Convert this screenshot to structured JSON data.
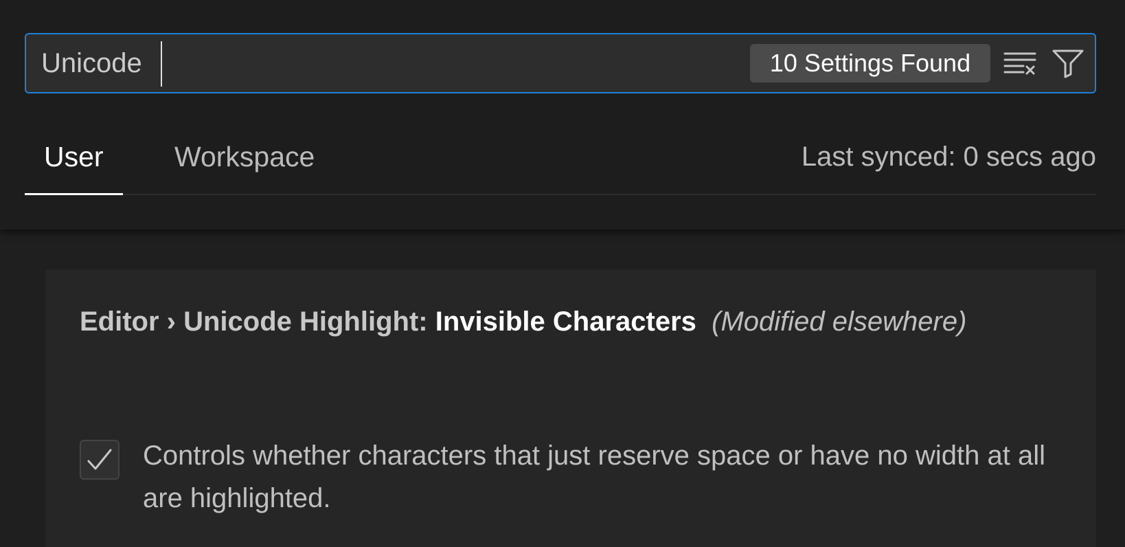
{
  "search": {
    "value": "Unicode",
    "result_count": "10 Settings Found"
  },
  "icons": {
    "clear": "clear-filter-icon",
    "filter": "filter-icon",
    "check": "checkmark-icon"
  },
  "tabs": [
    {
      "label": "User",
      "active": true
    },
    {
      "label": "Workspace",
      "active": false
    }
  ],
  "sync": {
    "status": "Last synced: 0 secs ago"
  },
  "setting": {
    "category": "Editor › Unicode Highlight: ",
    "name": "Invisible Characters",
    "modified_note": "(Modified elsewhere)",
    "checked": true,
    "description": "Controls whether characters that just reserve space or have no width at all are highlighted."
  },
  "colors": {
    "focus_border": "#1f7fd6",
    "background": "#1f1f1f",
    "card": "#262626"
  }
}
